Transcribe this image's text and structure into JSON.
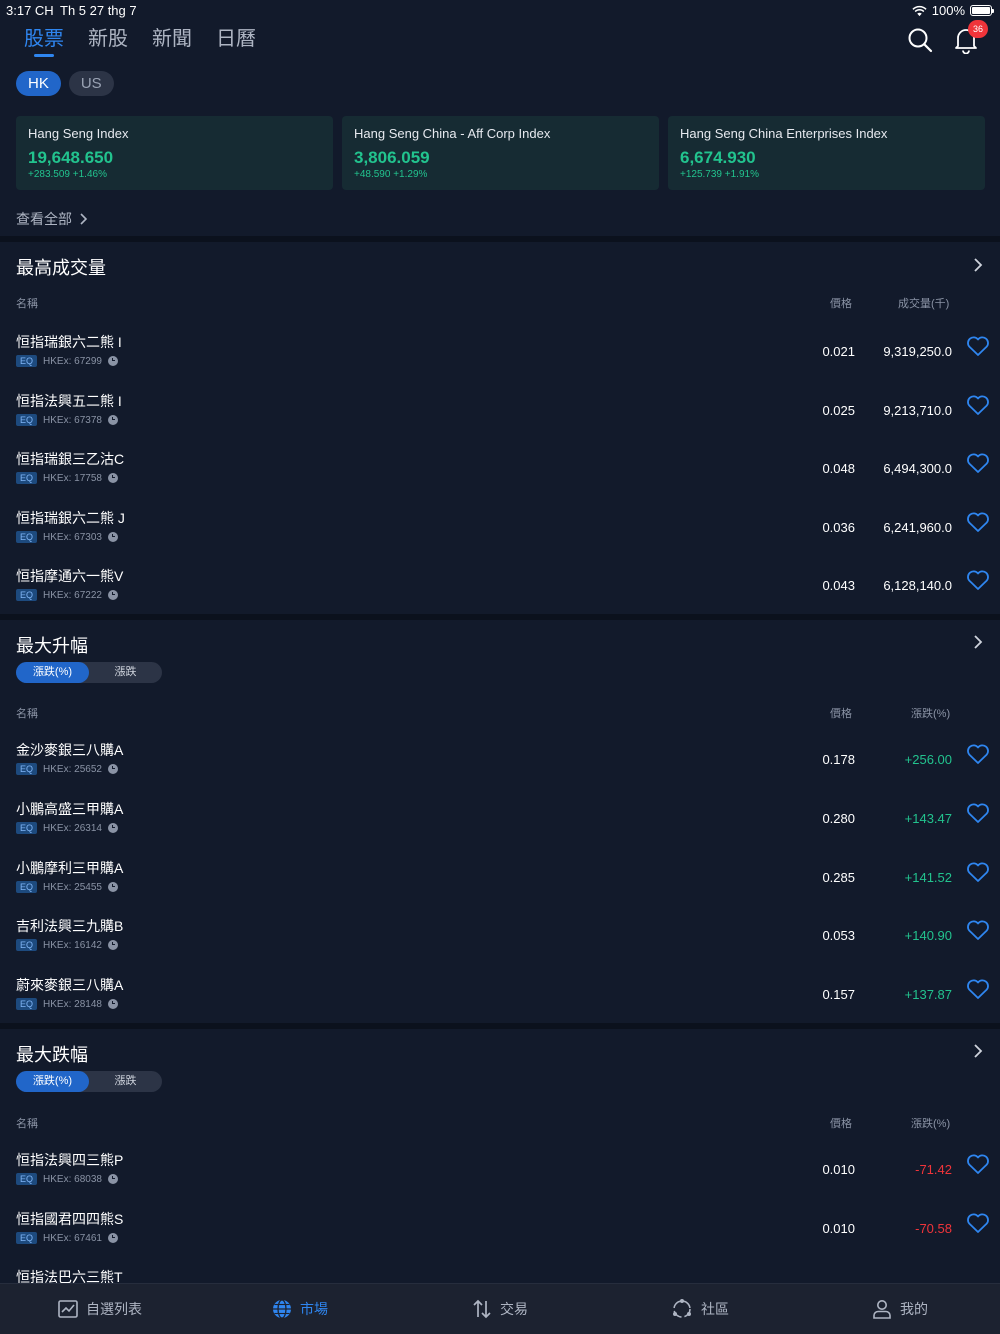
{
  "status_bar": {
    "time": "3:17 CH",
    "date": "Th 5 27 thg 7",
    "battery": "100%"
  },
  "top_tabs": [
    {
      "label": "股票",
      "active": true
    },
    {
      "label": "新股",
      "active": false
    },
    {
      "label": "新聞",
      "active": false
    },
    {
      "label": "日曆",
      "active": false
    }
  ],
  "notification_count": "36",
  "market_toggle": {
    "hk": "HK",
    "us": "US"
  },
  "indices": [
    {
      "name": "Hang Seng Index",
      "value": "19,648.650",
      "change": "+283.509 +1.46%"
    },
    {
      "name": "Hang Seng China - Aff Corp Index",
      "value": "3,806.059",
      "change": "+48.590 +1.29%"
    },
    {
      "name": "Hang Seng China Enterprises Index",
      "value": "6,674.930",
      "change": "+125.739 +1.91%"
    }
  ],
  "view_all": "查看全部",
  "volume": {
    "title": "最高成交量",
    "col_name": "名稱",
    "col_price": "價格",
    "col_third": "成交量(千)",
    "rows": [
      {
        "name": "恒指瑞銀六二熊 I",
        "tag": "EQ",
        "code": "HKEx: 67299",
        "price": "0.021",
        "third": "9,319,250.0"
      },
      {
        "name": "恒指法興五二熊 I",
        "tag": "EQ",
        "code": "HKEx: 67378",
        "price": "0.025",
        "third": "9,213,710.0"
      },
      {
        "name": "恒指瑞銀三乙沽C",
        "tag": "EQ",
        "code": "HKEx: 17758",
        "price": "0.048",
        "third": "6,494,300.0"
      },
      {
        "name": "恒指瑞銀六二熊 J",
        "tag": "EQ",
        "code": "HKEx: 67303",
        "price": "0.036",
        "third": "6,241,960.0"
      },
      {
        "name": "恒指摩通六一熊V",
        "tag": "EQ",
        "code": "HKEx: 67222",
        "price": "0.043",
        "third": "6,128,140.0"
      }
    ]
  },
  "gainers": {
    "title": "最大升幅",
    "toggle_pct": "漲跌(%)",
    "toggle_abs": "漲跌",
    "col_name": "名稱",
    "col_price": "價格",
    "col_third": "漲跌(%)",
    "rows": [
      {
        "name": "金沙麥銀三八購A",
        "tag": "EQ",
        "code": "HKEx: 25652",
        "price": "0.178",
        "third": "+256.00"
      },
      {
        "name": "小鵬高盛三甲購A",
        "tag": "EQ",
        "code": "HKEx: 26314",
        "price": "0.280",
        "third": "+143.47"
      },
      {
        "name": "小鵬摩利三甲購A",
        "tag": "EQ",
        "code": "HKEx: 25455",
        "price": "0.285",
        "third": "+141.52"
      },
      {
        "name": "吉利法興三九購B",
        "tag": "EQ",
        "code": "HKEx: 16142",
        "price": "0.053",
        "third": "+140.90"
      },
      {
        "name": "蔚來麥銀三八購A",
        "tag": "EQ",
        "code": "HKEx: 28148",
        "price": "0.157",
        "third": "+137.87"
      }
    ]
  },
  "losers": {
    "title": "最大跌幅",
    "toggle_pct": "漲跌(%)",
    "toggle_abs": "漲跌",
    "col_name": "名稱",
    "col_price": "價格",
    "col_third": "漲跌(%)",
    "rows": [
      {
        "name": "恒指法興四三熊P",
        "tag": "EQ",
        "code": "HKEx: 68038",
        "price": "0.010",
        "third": "-71.42"
      },
      {
        "name": "恒指國君四四熊S",
        "tag": "EQ",
        "code": "HKEx: 67461",
        "price": "0.010",
        "third": "-70.58"
      },
      {
        "name": "恒指法巴六三熊T",
        "tag": "",
        "code": "",
        "price": "",
        "third": ""
      }
    ]
  },
  "bottom_nav": [
    {
      "label": "自選列表",
      "icon": "chart-icon",
      "active": false
    },
    {
      "label": "市場",
      "icon": "globe-icon",
      "active": true
    },
    {
      "label": "交易",
      "icon": "swap-arrows-icon",
      "active": false
    },
    {
      "label": "社區",
      "icon": "community-icon",
      "active": false
    },
    {
      "label": "我的",
      "icon": "person-icon",
      "active": false
    }
  ],
  "colors": {
    "accent": "#2f86f0",
    "up": "#22c38e",
    "down": "#f0343a",
    "background": "#121a2b"
  }
}
